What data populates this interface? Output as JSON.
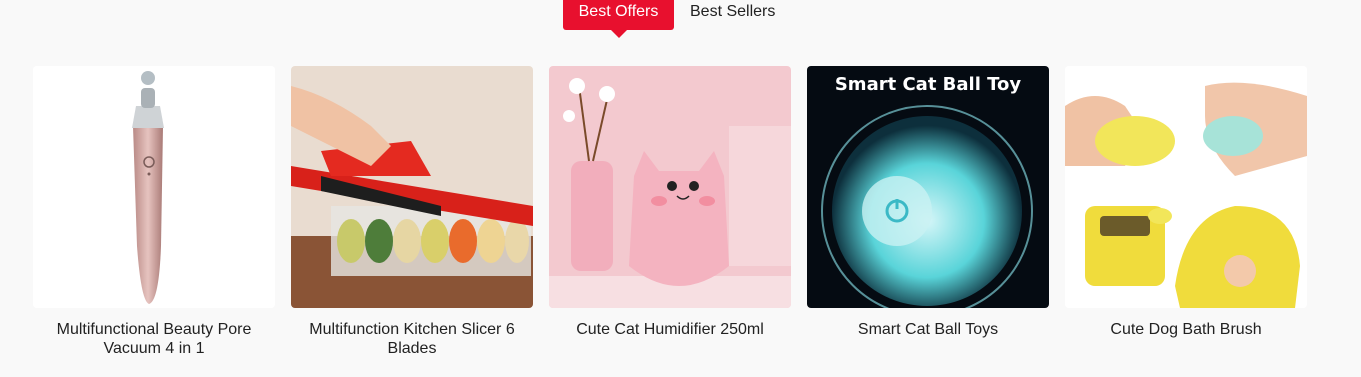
{
  "tabs": [
    {
      "label": "Best Offers",
      "active": true
    },
    {
      "label": "Best Sellers",
      "active": false
    }
  ],
  "products": [
    {
      "name": "Multifunctional Beauty Pore Vacuum 4 in 1"
    },
    {
      "name": "Multifunction Kitchen Slicer 6 Blades"
    },
    {
      "name": "Cute Cat Humidifier 250ml"
    },
    {
      "name": "Smart Cat Ball Toys",
      "image_caption": "Smart Cat Ball Toy"
    },
    {
      "name": "Cute Dog Bath Brush"
    }
  ],
  "colors": {
    "accent": "#e8102e",
    "background": "#f9f9f9"
  }
}
